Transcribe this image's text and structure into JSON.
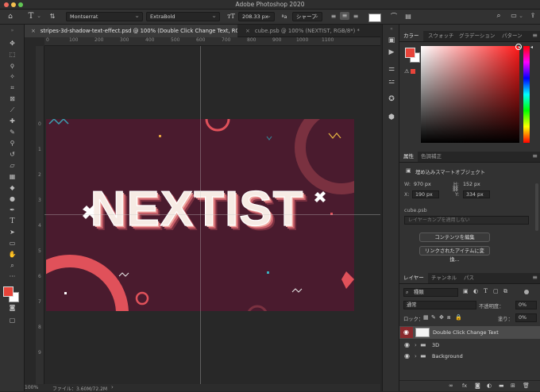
{
  "colors": {
    "accent": "#e94b4b",
    "canvas_bg": "#4a1b2e",
    "swatch_fg": "#e8443a"
  },
  "app": {
    "title": "Adobe Photoshop 2020"
  },
  "options_bar": {
    "font_family": "Montserrat",
    "font_style": "ExtraBold",
    "font_size": "208.33 px",
    "aa_label": "ªa",
    "anti_alias": "シャープ"
  },
  "doc_tabs": [
    {
      "label": "stripes-3d-shadow-text-effect.psd @ 100% (Double Click Change Text, RGB/8*) *",
      "active": true
    },
    {
      "label": "cube.psb @ 100% (NEXTIST, RGB/8*) *",
      "active": false
    }
  ],
  "ruler": {
    "top": [
      "0",
      "100",
      "200",
      "300",
      "400",
      "500",
      "600",
      "700",
      "800",
      "900",
      "1000",
      "1100"
    ],
    "left": [
      "0",
      "1",
      "2",
      "3",
      "4",
      "5",
      "6",
      "7",
      "8",
      "9"
    ]
  },
  "canvas": {
    "headline": "NEXTIST"
  },
  "status": {
    "zoom": "100%",
    "file_info": "ファイル：3.60M/72.2M"
  },
  "color_panel": {
    "tabs": [
      "カラー",
      "スウォッチ",
      "グラデーション",
      "パターン"
    ]
  },
  "properties": {
    "tabs": [
      "属性",
      "色調補正"
    ],
    "type_label": "埋め込みスマートオブジェクト",
    "w_label": "W:",
    "w_value": "970 px",
    "h_label": "H:",
    "h_value": "152 px",
    "x_label": "X:",
    "x_value": "190 px",
    "y_label": "Y:",
    "y_value": "334 px",
    "file": "cube.psb",
    "comp_placeholder": "レイヤーカンプを適用しない",
    "edit_button": "コンテンツを編集",
    "convert_button": "リンクされたアイテムに変換..."
  },
  "layers_panel": {
    "tabs": [
      "レイヤー",
      "チャンネル",
      "パス"
    ],
    "filter": "種類",
    "blend_mode": "通常",
    "opacity_label": "不透明度：",
    "opacity": "0%",
    "lock_label": "ロック：",
    "fill_label": "塗り：",
    "fill": "0%",
    "layers": [
      {
        "name": "Double Click Change Text",
        "type": "smart",
        "selected": true
      },
      {
        "name": "3D",
        "type": "group",
        "selected": false
      },
      {
        "name": "Background",
        "type": "group",
        "selected": false
      }
    ]
  }
}
